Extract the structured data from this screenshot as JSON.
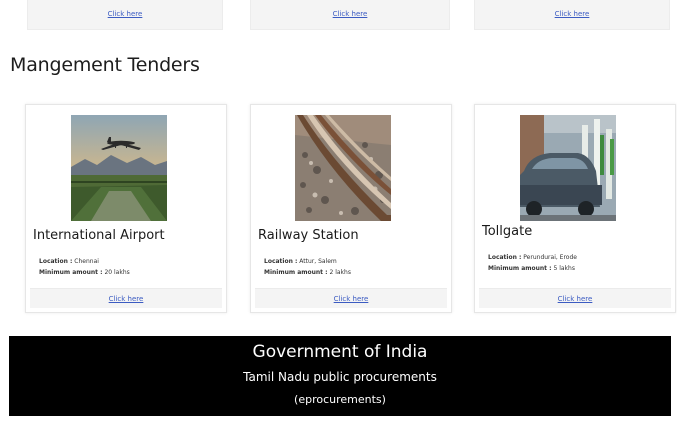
{
  "top_cards": [
    {
      "link": "Click here"
    },
    {
      "link": "Click here"
    },
    {
      "link": "Click here"
    }
  ],
  "section": {
    "title": "Mangement Tenders"
  },
  "tenders": [
    {
      "name": "International Airport",
      "location_label": "Location :",
      "location": "Chennai",
      "min_label": "Minimum amount :",
      "min": "20 lakhs",
      "link": "Click here",
      "image": "airplane-landing-photo"
    },
    {
      "name": "Railway Station",
      "location_label": "Location :",
      "location": "Attur, Salem",
      "min_label": "Minimum amount :",
      "min": "2 lakhs",
      "link": "Click here",
      "image": "railway-track-photo"
    },
    {
      "name": "Tollgate",
      "location_label": "Location :",
      "location": "Perundurai, Erode",
      "min_label": "Minimum amount :",
      "min": "5 lakhs",
      "link": "Click here",
      "image": "tollgate-car-photo"
    }
  ],
  "footer": {
    "line1": "Government of India",
    "line2": "Tamil Nadu public procurements",
    "line3": "(eprocurements)"
  }
}
